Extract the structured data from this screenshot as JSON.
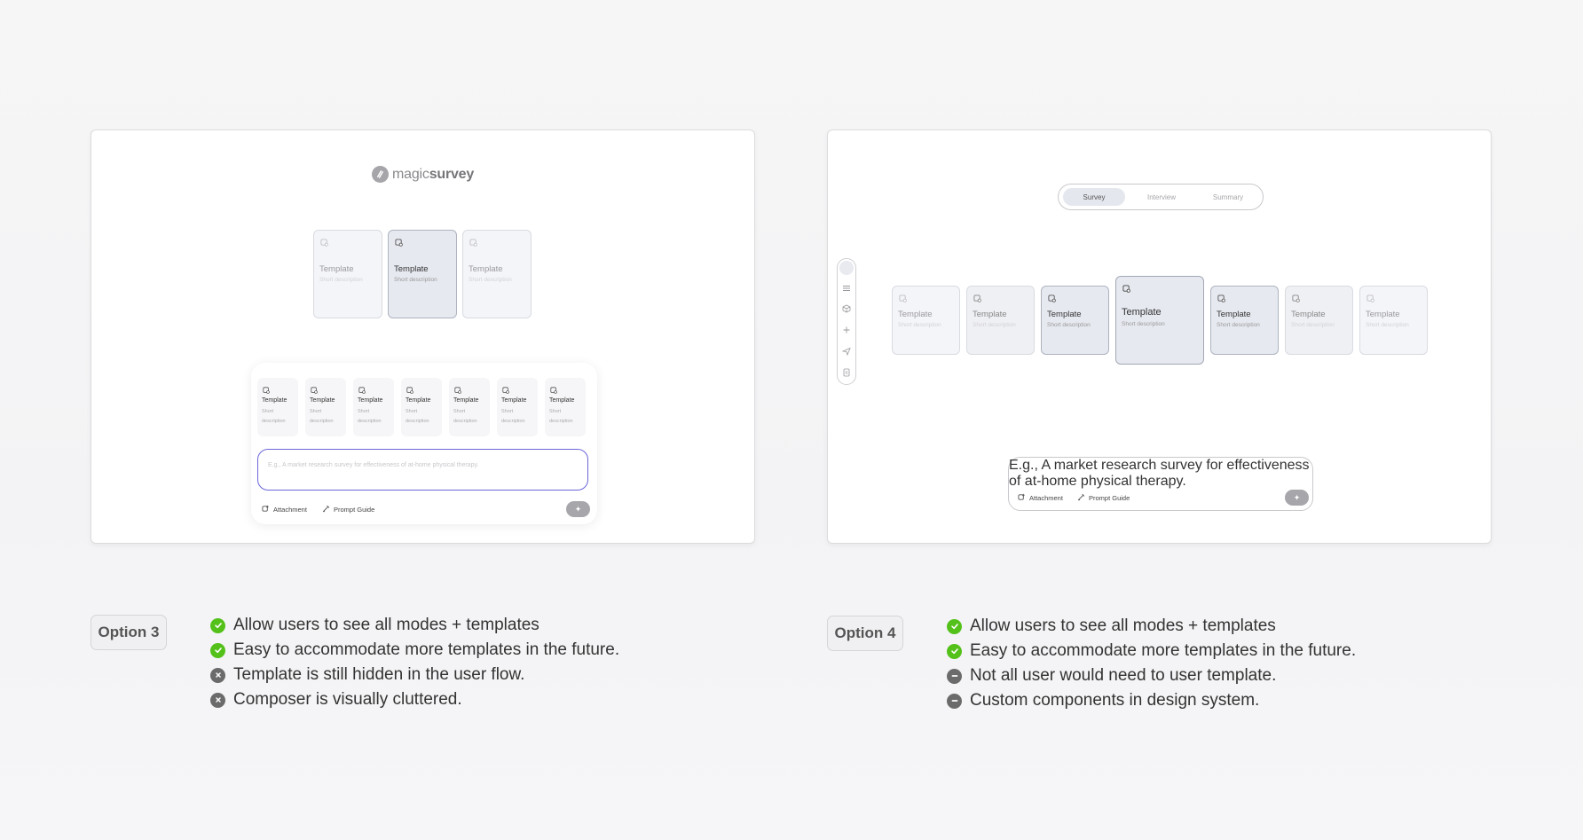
{
  "colors": {
    "accent": "#6a66d8",
    "pro": "#54c11a",
    "con": "#6b6b6b"
  },
  "option3": {
    "brand": {
      "light": "magic",
      "bold": "survey",
      "icon": "logo-swirl-icon"
    },
    "featured_templates": [
      {
        "name": "Template",
        "desc": "Short description",
        "selected": false
      },
      {
        "name": "Template",
        "desc": "Short description",
        "selected": true
      },
      {
        "name": "Template",
        "desc": "Short description",
        "selected": false
      }
    ],
    "composer": {
      "templates": [
        {
          "name": "Template",
          "desc": "Short description"
        },
        {
          "name": "Template",
          "desc": "Short description"
        },
        {
          "name": "Template",
          "desc": "Short description"
        },
        {
          "name": "Template",
          "desc": "Short description"
        },
        {
          "name": "Template",
          "desc": "Short description"
        },
        {
          "name": "Template",
          "desc": "Short description"
        },
        {
          "name": "Template",
          "desc": "Short description"
        }
      ],
      "placeholder": "E.g., A market research survey for effectiveness of at-home physical therapy.",
      "attachment_label": "Attachment",
      "prompt_guide_label": "Prompt Guide"
    },
    "label": "Option 3",
    "notes": [
      {
        "type": "pro",
        "text": "Allow users to see all modes + templates"
      },
      {
        "type": "pro",
        "text": "Easy to accommodate more templates in the future."
      },
      {
        "type": "con",
        "text": "Template is still hidden in the user flow."
      },
      {
        "type": "con",
        "text": "Composer is visually cluttered."
      }
    ]
  },
  "option4": {
    "tabs": [
      {
        "label": "Survey",
        "active": true
      },
      {
        "label": "Interview",
        "active": false
      },
      {
        "label": "Summary",
        "active": false
      }
    ],
    "carousel": [
      {
        "name": "Template",
        "desc": "Short description",
        "level": 0
      },
      {
        "name": "Template",
        "desc": "Short description",
        "level": 0
      },
      {
        "name": "Template",
        "desc": "Short description",
        "level": 1
      },
      {
        "name": "Template",
        "desc": "Short description",
        "level": 2
      },
      {
        "name": "Template",
        "desc": "Short description",
        "level": 1
      },
      {
        "name": "Template",
        "desc": "Short description",
        "level": 0
      },
      {
        "name": "Template",
        "desc": "Short description",
        "level": 0
      }
    ],
    "rail_icons": [
      "avatar",
      "menu-icon",
      "cube-icon",
      "plus-icon",
      "send-icon",
      "document-icon"
    ],
    "composer": {
      "placeholder": "E.g., A market research survey for effectiveness of at-home physical therapy.",
      "attachment_label": "Attachment",
      "prompt_guide_label": "Prompt Guide"
    },
    "label": "Option 4",
    "notes": [
      {
        "type": "pro",
        "text": "Allow users to see all modes + templates"
      },
      {
        "type": "pro",
        "text": "Easy to accommodate more templates in the future."
      },
      {
        "type": "neutral",
        "text": "Not all user would need to user template."
      },
      {
        "type": "neutral",
        "text": "Custom components in design system."
      }
    ]
  }
}
